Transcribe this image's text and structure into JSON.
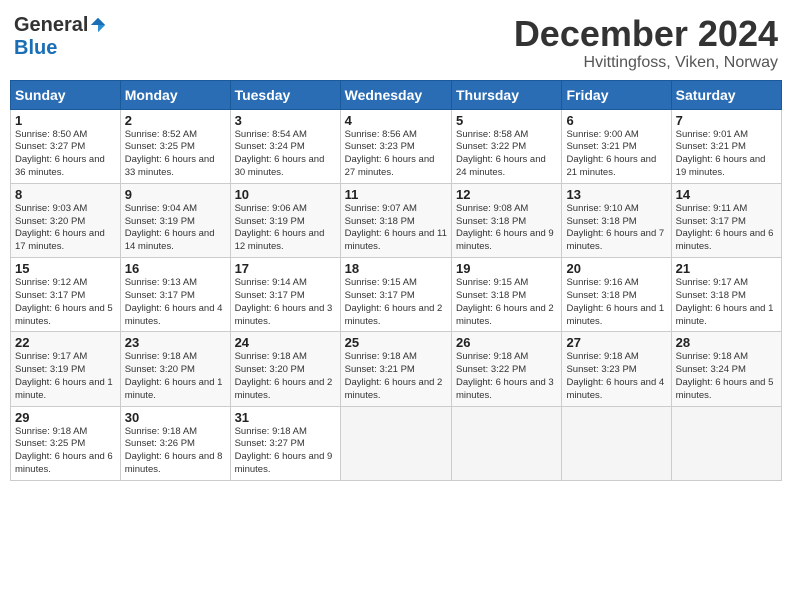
{
  "header": {
    "logo_general": "General",
    "logo_blue": "Blue",
    "month": "December 2024",
    "location": "Hvittingfoss, Viken, Norway"
  },
  "days_of_week": [
    "Sunday",
    "Monday",
    "Tuesday",
    "Wednesday",
    "Thursday",
    "Friday",
    "Saturday"
  ],
  "weeks": [
    [
      {
        "day": "1",
        "sunrise": "8:50 AM",
        "sunset": "3:27 PM",
        "daylight": "6 hours and 36 minutes."
      },
      {
        "day": "2",
        "sunrise": "8:52 AM",
        "sunset": "3:25 PM",
        "daylight": "6 hours and 33 minutes."
      },
      {
        "day": "3",
        "sunrise": "8:54 AM",
        "sunset": "3:24 PM",
        "daylight": "6 hours and 30 minutes."
      },
      {
        "day": "4",
        "sunrise": "8:56 AM",
        "sunset": "3:23 PM",
        "daylight": "6 hours and 27 minutes."
      },
      {
        "day": "5",
        "sunrise": "8:58 AM",
        "sunset": "3:22 PM",
        "daylight": "6 hours and 24 minutes."
      },
      {
        "day": "6",
        "sunrise": "9:00 AM",
        "sunset": "3:21 PM",
        "daylight": "6 hours and 21 minutes."
      },
      {
        "day": "7",
        "sunrise": "9:01 AM",
        "sunset": "3:21 PM",
        "daylight": "6 hours and 19 minutes."
      }
    ],
    [
      {
        "day": "8",
        "sunrise": "9:03 AM",
        "sunset": "3:20 PM",
        "daylight": "6 hours and 17 minutes."
      },
      {
        "day": "9",
        "sunrise": "9:04 AM",
        "sunset": "3:19 PM",
        "daylight": "6 hours and 14 minutes."
      },
      {
        "day": "10",
        "sunrise": "9:06 AM",
        "sunset": "3:19 PM",
        "daylight": "6 hours and 12 minutes."
      },
      {
        "day": "11",
        "sunrise": "9:07 AM",
        "sunset": "3:18 PM",
        "daylight": "6 hours and 11 minutes."
      },
      {
        "day": "12",
        "sunrise": "9:08 AM",
        "sunset": "3:18 PM",
        "daylight": "6 hours and 9 minutes."
      },
      {
        "day": "13",
        "sunrise": "9:10 AM",
        "sunset": "3:18 PM",
        "daylight": "6 hours and 7 minutes."
      },
      {
        "day": "14",
        "sunrise": "9:11 AM",
        "sunset": "3:17 PM",
        "daylight": "6 hours and 6 minutes."
      }
    ],
    [
      {
        "day": "15",
        "sunrise": "9:12 AM",
        "sunset": "3:17 PM",
        "daylight": "6 hours and 5 minutes."
      },
      {
        "day": "16",
        "sunrise": "9:13 AM",
        "sunset": "3:17 PM",
        "daylight": "6 hours and 4 minutes."
      },
      {
        "day": "17",
        "sunrise": "9:14 AM",
        "sunset": "3:17 PM",
        "daylight": "6 hours and 3 minutes."
      },
      {
        "day": "18",
        "sunrise": "9:15 AM",
        "sunset": "3:17 PM",
        "daylight": "6 hours and 2 minutes."
      },
      {
        "day": "19",
        "sunrise": "9:15 AM",
        "sunset": "3:18 PM",
        "daylight": "6 hours and 2 minutes."
      },
      {
        "day": "20",
        "sunrise": "9:16 AM",
        "sunset": "3:18 PM",
        "daylight": "6 hours and 1 minutes."
      },
      {
        "day": "21",
        "sunrise": "9:17 AM",
        "sunset": "3:18 PM",
        "daylight": "6 hours and 1 minute."
      }
    ],
    [
      {
        "day": "22",
        "sunrise": "9:17 AM",
        "sunset": "3:19 PM",
        "daylight": "6 hours and 1 minute."
      },
      {
        "day": "23",
        "sunrise": "9:18 AM",
        "sunset": "3:20 PM",
        "daylight": "6 hours and 1 minute."
      },
      {
        "day": "24",
        "sunrise": "9:18 AM",
        "sunset": "3:20 PM",
        "daylight": "6 hours and 2 minutes."
      },
      {
        "day": "25",
        "sunrise": "9:18 AM",
        "sunset": "3:21 PM",
        "daylight": "6 hours and 2 minutes."
      },
      {
        "day": "26",
        "sunrise": "9:18 AM",
        "sunset": "3:22 PM",
        "daylight": "6 hours and 3 minutes."
      },
      {
        "day": "27",
        "sunrise": "9:18 AM",
        "sunset": "3:23 PM",
        "daylight": "6 hours and 4 minutes."
      },
      {
        "day": "28",
        "sunrise": "9:18 AM",
        "sunset": "3:24 PM",
        "daylight": "6 hours and 5 minutes."
      }
    ],
    [
      {
        "day": "29",
        "sunrise": "9:18 AM",
        "sunset": "3:25 PM",
        "daylight": "6 hours and 6 minutes."
      },
      {
        "day": "30",
        "sunrise": "9:18 AM",
        "sunset": "3:26 PM",
        "daylight": "6 hours and 8 minutes."
      },
      {
        "day": "31",
        "sunrise": "9:18 AM",
        "sunset": "3:27 PM",
        "daylight": "6 hours and 9 minutes."
      },
      null,
      null,
      null,
      null
    ]
  ],
  "labels": {
    "sunrise": "Sunrise:",
    "sunset": "Sunset:",
    "daylight": "Daylight:"
  }
}
